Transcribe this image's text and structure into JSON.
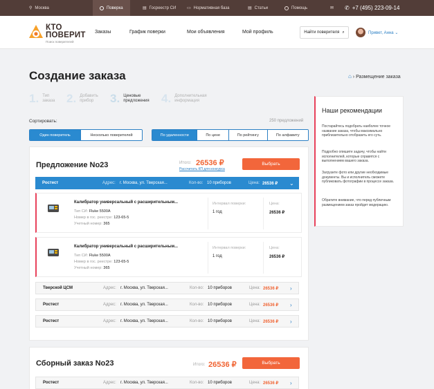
{
  "topbar": {
    "city": "Москва",
    "nav": [
      "Поверка",
      "Госреестр СИ",
      "Нормативная база",
      "Статьи",
      "Помощь"
    ],
    "phone": "+7 (495) 223-09-14"
  },
  "header": {
    "logo_line1": "КТО",
    "logo_line2": "ПОВЕРИТ",
    "logo_sub": "Поиск поверителей",
    "nav": [
      "Заказы",
      "График поверки",
      "Мои объявления",
      "Мой профиль"
    ],
    "find_button": "Найти поверителя",
    "greeting": "Привет, Анна"
  },
  "page": {
    "title": "Создание заказа",
    "breadcrumb": "Размещение заказа"
  },
  "steps": [
    {
      "num": "1.",
      "label1": "Тип",
      "label2": "заказа"
    },
    {
      "num": "2.",
      "label1": "Добавить",
      "label2": "прибор"
    },
    {
      "num": "3.",
      "label1": "Ценовые",
      "label2": "предложения"
    },
    {
      "num": "4.",
      "label1": "Дополнительная",
      "label2": "информация"
    }
  ],
  "sort": {
    "label": "Сортировать:",
    "count": "250 предложений",
    "mode": [
      "Один поверитель",
      "Несколько поверителей"
    ],
    "order": [
      "По удаленности",
      "По цене",
      "По рейтингу",
      "По алфавиту"
    ]
  },
  "offer1": {
    "title": "Предложение No23",
    "total_label": "Итого:",
    "total": "26536 ₽",
    "calc_link": "Рассчитать КП для конкурса",
    "button": "Выбрать",
    "main_org": {
      "name": "Ростест",
      "addr_label": "Адрес:",
      "addr": "г. Москва, ул. Тверская...",
      "qty_label": "Кол-во:",
      "qty": "10 приборов",
      "price_label": "Цена:",
      "price": "26536 ₽"
    },
    "devices": [
      {
        "name": "Калибратор универсальный с расширительным...",
        "type_label": "Тип СИ:",
        "type": "Fluke 5500A",
        "reg_label": "Номер в гос. реестре:",
        "reg": "123-65-5",
        "acc_label": "Учетный номер:",
        "acc": "365",
        "interval_label": "Интервал поверки:",
        "interval": "1 год",
        "price_label": "Цена:",
        "price": "26536 ₽"
      },
      {
        "name": "Калибратор универсальный с расширительным...",
        "type_label": "Тип СИ:",
        "type": "Fluke 5500A",
        "reg_label": "Номер в гос. реестре:",
        "reg": "123-65-5",
        "acc_label": "Учетный номер:",
        "acc": "365",
        "interval_label": "Интервал поверки:",
        "interval": "1 год",
        "price_label": "Цена:",
        "price": "26536 ₽"
      }
    ],
    "other_orgs": [
      {
        "name": "Тверской ЦСМ",
        "addr_label": "Адрес:",
        "addr": "г. Москва, ул. Тверская...",
        "qty_label": "Кол-во:",
        "qty": "10 приборов",
        "price_label": "Цена:",
        "price": "26536 ₽"
      },
      {
        "name": "Ростест",
        "addr_label": "Адрес:",
        "addr": "г. Москва, ул. Тверская...",
        "qty_label": "Кол-во:",
        "qty": "10 приборов",
        "price_label": "Цена:",
        "price": "26536 ₽"
      },
      {
        "name": "Ростест",
        "addr_label": "Адрес:",
        "addr": "г. Москва, ул. Тверская...",
        "qty_label": "Кол-во:",
        "qty": "10 приборов",
        "price_label": "Цена:",
        "price": "26536 ₽"
      }
    ]
  },
  "offer2": {
    "title": "Сборный заказ No23",
    "total_label": "Итого:",
    "total": "26536 ₽",
    "button": "Выбрать",
    "org": {
      "name": "Ростест",
      "addr_label": "Адрес:",
      "addr": "г. Москва, ул. Тверская...",
      "qty_label": "Кол-во:",
      "qty": "10 приборов",
      "price_label": "Цена:",
      "price": "26536 ₽"
    }
  },
  "recs": {
    "title": "Наши рекомендации",
    "p1": "Постарайтесь подобрать наиболее точное название заказа, чтобы максимально приблизительно отобразить его суть.",
    "p2": "Подробно опишите задачу, чтобы найти исполнителей, которые справятся с выполнением вашего заказа.",
    "p3": "Загрузите фото или другие необходимые документы. Вы и исполнитель сможете публиковать фотографии в процессе заказа.",
    "p4": "Обратите внимание, что перед публичным размещением заказ пройдет модерацию."
  },
  "colors": {
    "topbar": "#523d38",
    "accent_blue": "#2a8ad0",
    "accent_orange": "#f2663b",
    "accent_red": "#e8415a"
  }
}
